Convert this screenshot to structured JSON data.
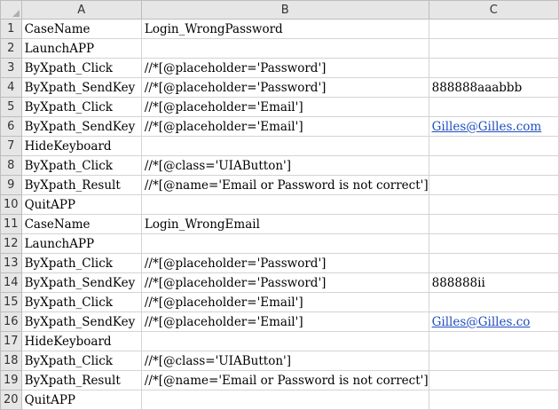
{
  "columns": [
    "A",
    "B",
    "C"
  ],
  "rows": [
    {
      "n": "1",
      "a": "CaseName",
      "b": "Login_WrongPassword",
      "c": ""
    },
    {
      "n": "2",
      "a": "LaunchAPP",
      "b": "",
      "c": ""
    },
    {
      "n": "3",
      "a": "ByXpath_Click",
      "b": "//*[@placeholder='Password']",
      "c": ""
    },
    {
      "n": "4",
      "a": "ByXpath_SendKey",
      "b": "//*[@placeholder='Password']",
      "c": "888888aaabbb"
    },
    {
      "n": "5",
      "a": "ByXpath_Click",
      "b": "//*[@placeholder='Email']",
      "c": ""
    },
    {
      "n": "6",
      "a": "ByXpath_SendKey",
      "b": "//*[@placeholder='Email']",
      "c": "Gilles@Gilles.com",
      "c_link": true
    },
    {
      "n": "7",
      "a": "HideKeyboard",
      "b": "",
      "c": ""
    },
    {
      "n": "8",
      "a": "ByXpath_Click",
      "b": "//*[@class='UIAButton']",
      "c": ""
    },
    {
      "n": "9",
      "a": "ByXpath_Result",
      "b": "//*[@name='Email or Password is not correct']",
      "c": ""
    },
    {
      "n": "10",
      "a": "QuitAPP",
      "b": "",
      "c": ""
    },
    {
      "n": "11",
      "a": "CaseName",
      "b": "Login_WrongEmail",
      "c": ""
    },
    {
      "n": "12",
      "a": "LaunchAPP",
      "b": "",
      "c": ""
    },
    {
      "n": "13",
      "a": "ByXpath_Click",
      "b": "//*[@placeholder='Password']",
      "c": ""
    },
    {
      "n": "14",
      "a": "ByXpath_SendKey",
      "b": "//*[@placeholder='Password']",
      "c": "888888ii"
    },
    {
      "n": "15",
      "a": "ByXpath_Click",
      "b": "//*[@placeholder='Email']",
      "c": ""
    },
    {
      "n": "16",
      "a": "ByXpath_SendKey",
      "b": "//*[@placeholder='Email']",
      "c": "Gilles@Gilles.co",
      "c_link": true
    },
    {
      "n": "17",
      "a": "HideKeyboard",
      "b": "",
      "c": ""
    },
    {
      "n": "18",
      "a": "ByXpath_Click",
      "b": "//*[@class='UIAButton']",
      "c": ""
    },
    {
      "n": "19",
      "a": "ByXpath_Result",
      "b": "//*[@name='Email or Password is not correct']",
      "c": ""
    },
    {
      "n": "20",
      "a": "QuitAPP",
      "b": "",
      "c": ""
    }
  ]
}
